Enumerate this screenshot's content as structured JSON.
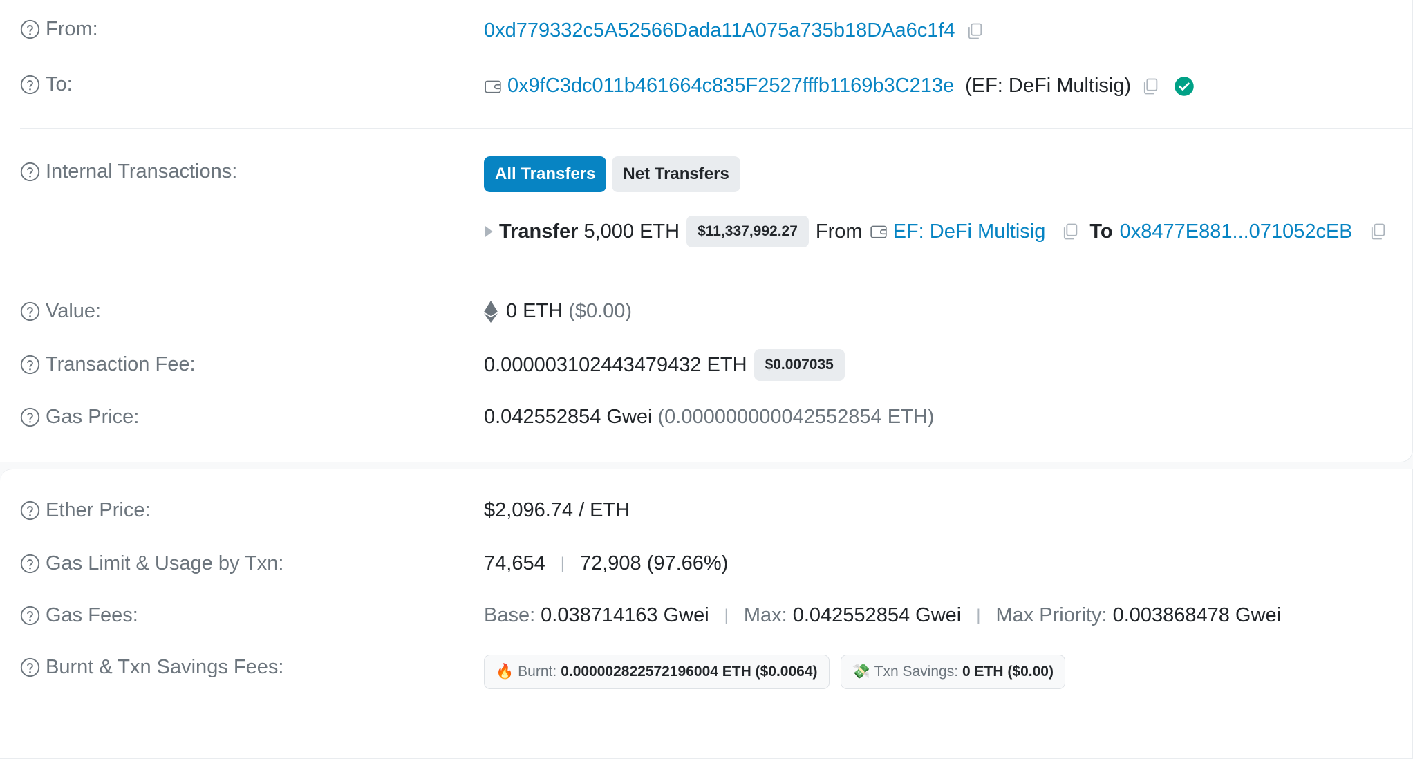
{
  "from": {
    "label": "From:",
    "address": "0xd779332c5A52566Dada11A075a735b18DAa6c1f4"
  },
  "to": {
    "label": "To:",
    "address": "0x9fC3dc011b461664c835F2527fffb1169b3C213e",
    "name_tag": "(EF: DeFi Multisig)"
  },
  "internal": {
    "label": "Internal Transactions:",
    "tabs": [
      "All Transfers",
      "Net Transfers"
    ],
    "transfer": {
      "type": "Transfer",
      "amount": "5,000 ETH",
      "usd": "$11,337,992.27",
      "from_word": "From",
      "from_name": "EF: DeFi Multisig",
      "to_word": "To",
      "to_address": "0x8477E881...071052cEB"
    }
  },
  "value": {
    "label": "Value:",
    "amount": "0 ETH",
    "usd": "($0.00)"
  },
  "fee": {
    "label": "Transaction Fee:",
    "amount": "0.000003102443479432 ETH",
    "usd": "$0.007035"
  },
  "gas_price": {
    "label": "Gas Price:",
    "gwei": "0.042552854 Gwei",
    "eth": "(0.000000000042552854 ETH)"
  },
  "ether_price": {
    "label": "Ether Price:",
    "value": "$2,096.74 / ETH"
  },
  "gas_limit": {
    "label": "Gas Limit & Usage by Txn:",
    "limit": "74,654",
    "separator": "|",
    "usage": "72,908 (97.66%)"
  },
  "gas_fees": {
    "label": "Gas Fees:",
    "base_label": "Base:",
    "base": "0.038714163 Gwei",
    "max_label": "Max:",
    "max": "0.042552854 Gwei",
    "priority_label": "Max Priority:",
    "priority": "0.003868478 Gwei",
    "separator": "|"
  },
  "burnt": {
    "label": "Burnt & Txn Savings Fees:",
    "burnt_icon": "🔥",
    "burnt_label": "Burnt:",
    "burnt_value": "0.000002822572196004 ETH ($0.0064)",
    "savings_icon": "💸",
    "savings_label": "Txn Savings:",
    "savings_value": "0 ETH ($0.00)"
  },
  "colors": {
    "link": "#0784c3",
    "muted": "#6c757d",
    "verified": "#00a186",
    "badge_bg": "#e9ecef"
  },
  "icons": [
    "question-circle-icon",
    "copy-icon",
    "wallet-icon",
    "verified-check-icon",
    "caret-right-icon",
    "ethereum-icon",
    "fire-icon",
    "money-wings-icon"
  ]
}
